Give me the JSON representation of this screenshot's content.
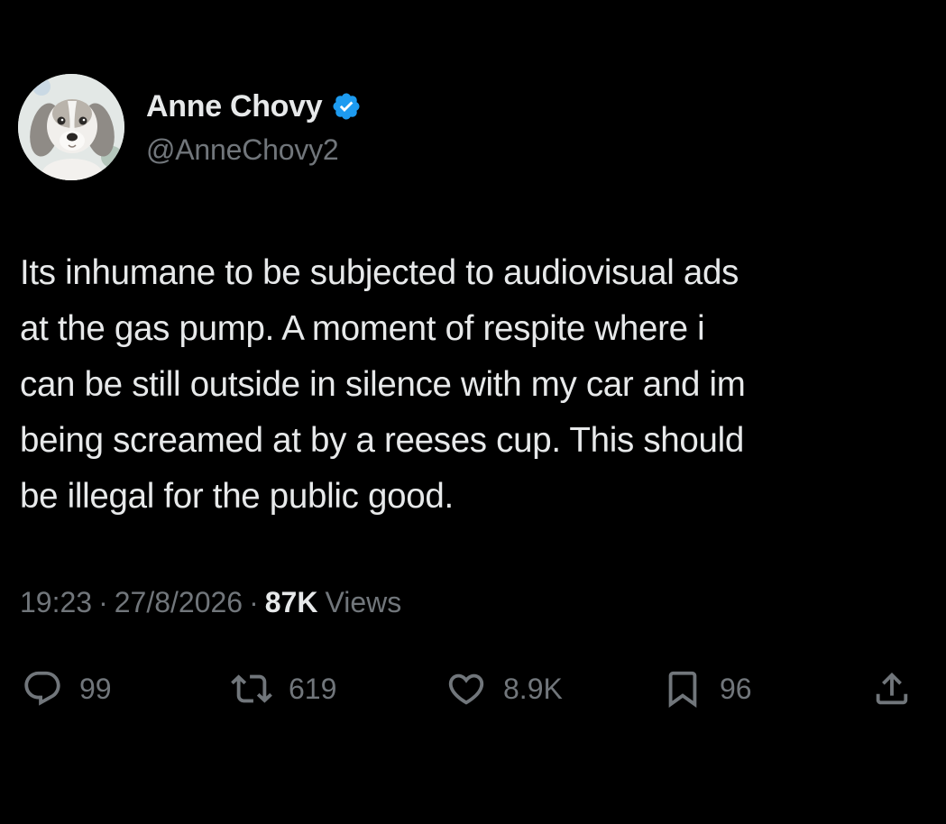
{
  "author": {
    "display_name": "Anne Chovy",
    "handle": "@AnneChovy2",
    "verified": true,
    "verified_badge_color": "#1d9bf0"
  },
  "tweet": {
    "text": "Its inhumane to be subjected to audiovisual ads\nat the gas pump. A moment of respite where i\ncan be still outside in silence with my car and im\nbeing screamed at by a reeses cup. This should\nbe illegal for the public good.",
    "time": "19:23",
    "date": "27/8/2026",
    "separator": "·",
    "views_count": "87K",
    "views_label": "Views"
  },
  "actions": {
    "replies": "99",
    "retweets": "619",
    "likes": "8.9K",
    "bookmarks": "96"
  },
  "icons": {
    "reply": "speech-bubble-icon",
    "retweet": "retweet-arrows-icon",
    "like": "heart-icon",
    "bookmark": "bookmark-icon",
    "share": "share-upload-icon",
    "verified": "verified-check-icon"
  },
  "theme": {
    "background": "#000000",
    "primary_text": "#e7e9ea",
    "secondary_text": "#71767b",
    "accent": "#1d9bf0"
  }
}
